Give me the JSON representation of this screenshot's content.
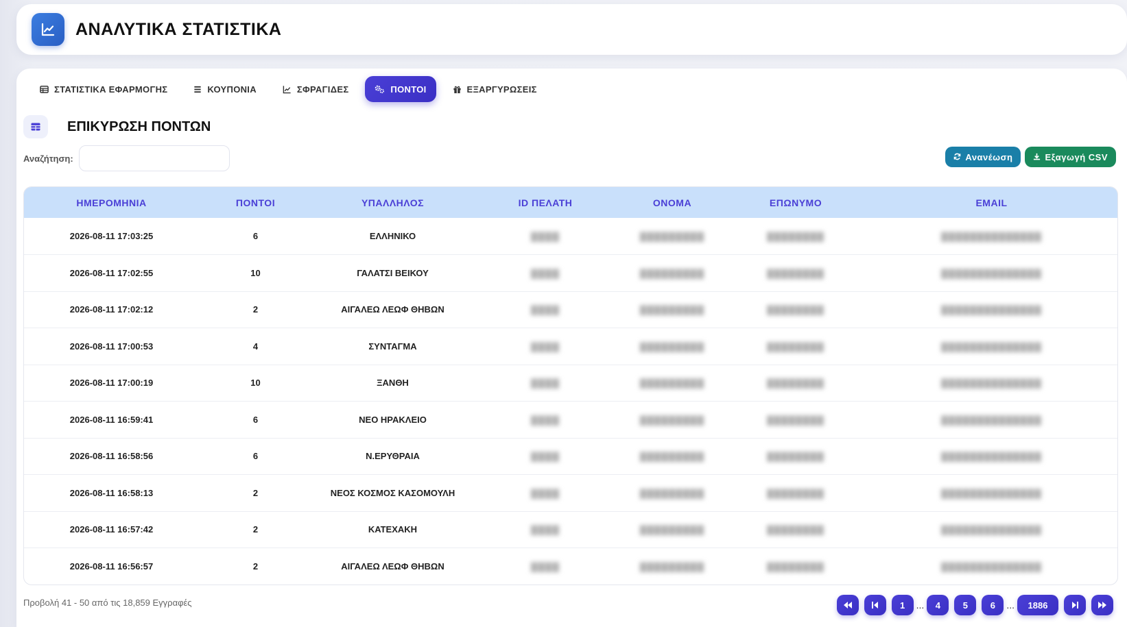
{
  "app": {
    "title": "ΑΝΑΛΥΤΙΚΑ ΣΤΑΤΙΣΤΙΚΑ",
    "logo_icon": "line-chart-icon"
  },
  "tabs": [
    {
      "label": "ΣΤΑΤΙΣΤΙΚΑ ΕΦΑΡΜΟΓΗΣ",
      "icon": "table-list-icon",
      "active": false
    },
    {
      "label": "ΚΟΥΠΟΝΙΑ",
      "icon": "list-icon",
      "active": false
    },
    {
      "label": "ΣΦΡΑΓΙΔΕΣ",
      "icon": "line-chart-icon",
      "active": false
    },
    {
      "label": "ΠΟΝΤΟΙ",
      "icon": "gears-icon",
      "active": true
    },
    {
      "label": "ΕΞΑΡΓΥΡΩΣΕΙΣ",
      "icon": "gift-icon",
      "active": false
    }
  ],
  "section": {
    "title": "ΕΠΙΚΥΡΩΣΗ ΠΟΝΤΩΝ",
    "icon": "table-icon"
  },
  "search": {
    "label": "Αναζήτηση:",
    "value": "",
    "placeholder": ""
  },
  "actions": {
    "refresh_label": "Ανανέωση",
    "export_label": "Εξαγωγή CSV"
  },
  "table": {
    "columns": [
      "ΗΜΕΡΟΜΗΝΙΑ",
      "ΠΟΝΤΟΙ",
      "ΥΠΑΛΛΗΛΟΣ",
      "ID ΠΕΛΑΤΗ",
      "ΟΝΟΜΑ",
      "ΕΠΩΝΥΜΟ",
      "EMAIL"
    ],
    "rows": [
      [
        "2026-08-11 17:03:25",
        "6",
        "ΕΛΛΗΝΙΚΟ"
      ],
      [
        "2026-08-11 17:02:55",
        "10",
        "ΓΑΛΑΤΣΙ ΒΕΙΚΟΥ"
      ],
      [
        "2026-08-11 17:02:12",
        "2",
        "ΑΙΓΑΛΕΩ ΛΕΩΦ ΘΗΒΩΝ"
      ],
      [
        "2026-08-11 17:00:53",
        "4",
        "ΣΥΝΤΑΓΜΑ"
      ],
      [
        "2026-08-11 17:00:19",
        "10",
        "ΞΑΝΘΗ"
      ],
      [
        "2026-08-11 16:59:41",
        "6",
        "ΝΕΟ ΗΡΑΚΛΕΙΟ"
      ],
      [
        "2026-08-11 16:58:56",
        "6",
        "Ν.ΕΡΥΘΡΑΙΑ"
      ],
      [
        "2026-08-11 16:58:13",
        "2",
        "ΝΕΟΣ ΚΟΣΜΟΣ ΚΑΣΟΜΟΥΛΗ"
      ],
      [
        "2026-08-11 16:57:42",
        "2",
        "ΚΑΤΕΧΑΚΗ"
      ],
      [
        "2026-08-11 16:56:57",
        "2",
        "ΑΙΓΑΛΕΩ ΛΕΩΦ ΘΗΒΩΝ"
      ]
    ]
  },
  "footer": {
    "info": "Προβολή 41 - 50 από τις 18,859 Εγγραφές"
  },
  "pagination": {
    "first_icon": "double-left-icon",
    "prev_icon": "step-back-icon",
    "pages": [
      "1",
      "4",
      "5",
      "6",
      "1886"
    ],
    "next_icon": "step-forward-icon",
    "last_icon": "double-right-icon",
    "ellipsis": "..."
  },
  "colors": {
    "accent": "#4a3fd6",
    "table_header_bg": "#c9e0fb",
    "refresh_btn": "#1a7fa8",
    "export_btn": "#1a8a5c"
  }
}
